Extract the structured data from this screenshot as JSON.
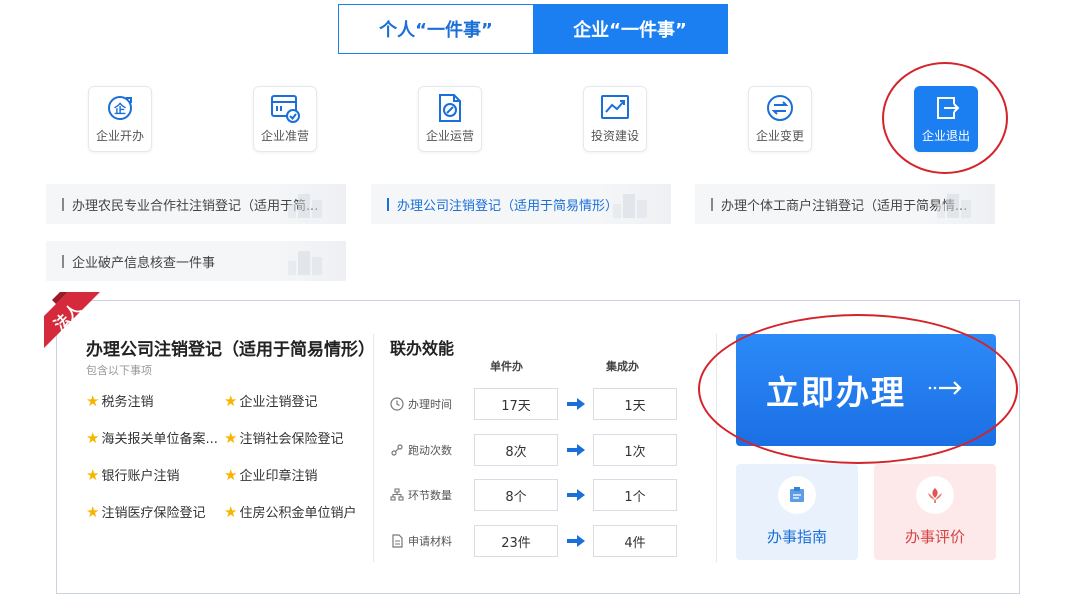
{
  "tabs": [
    {
      "label": "个人“一件事”",
      "active": false
    },
    {
      "label": "企业“一件事”",
      "active": true
    }
  ],
  "categories": [
    {
      "label": "企业开办",
      "icon": "company-open-icon"
    },
    {
      "label": "企业准营",
      "icon": "permit-icon"
    },
    {
      "label": "企业运营",
      "icon": "operation-icon"
    },
    {
      "label": "投资建设",
      "icon": "investment-icon"
    },
    {
      "label": "企业变更",
      "icon": "change-icon"
    },
    {
      "label": "企业退出",
      "icon": "exit-icon",
      "active": true
    }
  ],
  "items": [
    {
      "label": "办理农民专业合作社注销登记（适用于简..."
    },
    {
      "label": "办理公司注销登记（适用于简易情形）",
      "selected": true
    },
    {
      "label": "办理个体工商户注销登记（适用于简易情..."
    },
    {
      "label": "企业破产信息核查一件事"
    }
  ],
  "detail": {
    "ribbon": "法人",
    "title": "办理公司注销登记（适用于简易情形）",
    "subtitle": "包含以下事项",
    "sub_items": [
      "税务注销",
      "企业注销登记",
      "海关报关单位备案...",
      "注销社会保险登记",
      "银行账户注销",
      "企业印章注销",
      "注销医疗保险登记",
      "住房公积金单位销户"
    ]
  },
  "efficiency": {
    "title": "联办效能",
    "col_single": "单件办",
    "col_integrated": "集成办",
    "rows": [
      {
        "label": "办理时间",
        "icon": "clock-icon",
        "single": "17天",
        "integrated": "1天"
      },
      {
        "label": "跑动次数",
        "icon": "route-icon",
        "single": "8次",
        "integrated": "1次"
      },
      {
        "label": "环节数量",
        "icon": "steps-icon",
        "single": "8个",
        "integrated": "1个"
      },
      {
        "label": "申请材料",
        "icon": "document-icon",
        "single": "23件",
        "integrated": "4件"
      }
    ]
  },
  "actions": {
    "apply_label": "立即办理",
    "guide_label": "办事指南",
    "rate_label": "办事评价"
  },
  "colors": {
    "primary": "#1b7ff2",
    "highlight_ring": "#d4232a",
    "star": "#f7b500",
    "ribbon": "#d42a3c"
  }
}
